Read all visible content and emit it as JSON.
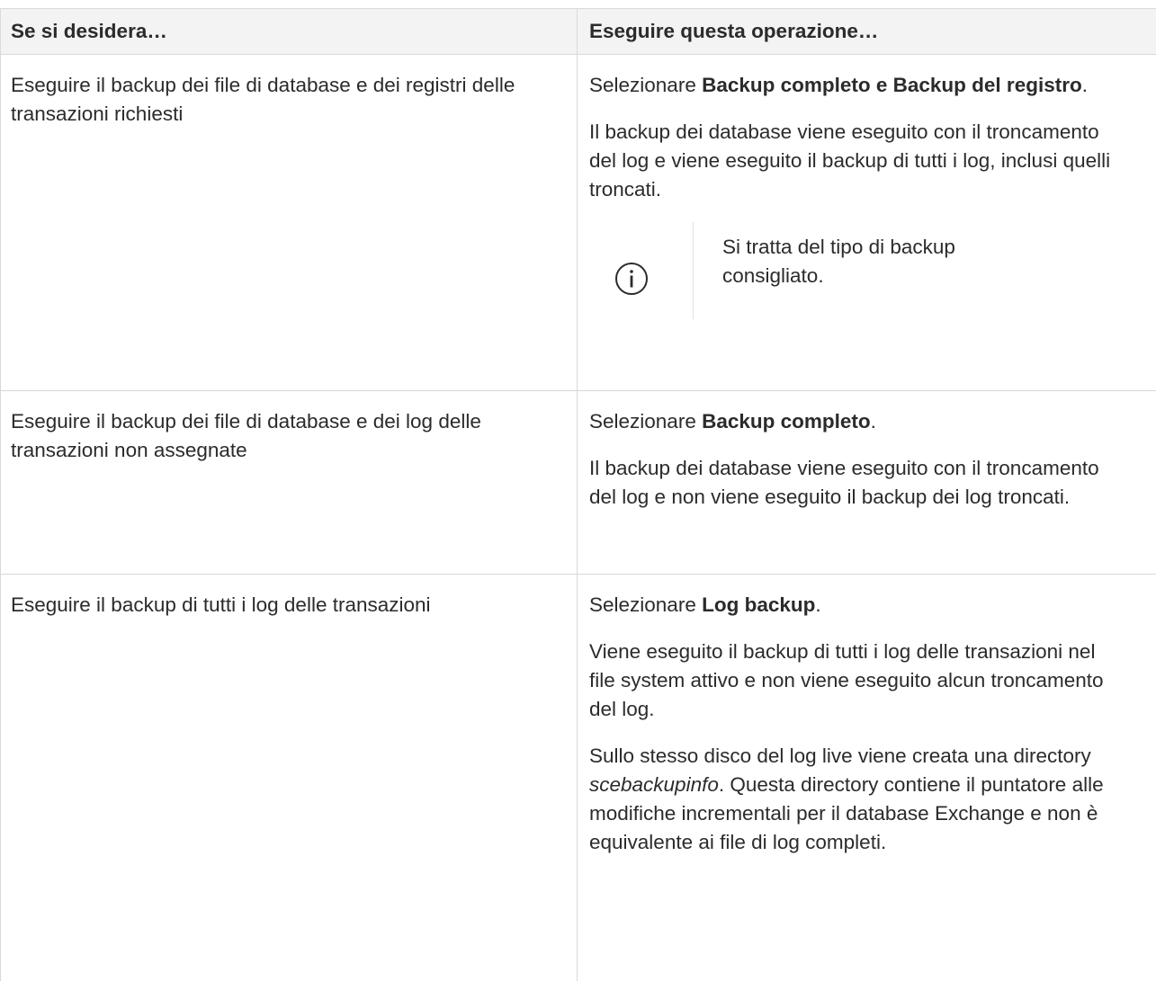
{
  "table": {
    "headers": [
      "Se si desidera…",
      "Eseguire questa operazione…"
    ],
    "rows": [
      {
        "want": "Eseguire il backup dei file di database e dei registri delle transazioni richiesti",
        "select_prefix": "Selezionare ",
        "select_bold": "Backup completo e Backup del registro",
        "select_suffix": ".",
        "description": "Il backup dei database viene eseguito con il troncamento del log e viene eseguito il backup di tutti i log, inclusi quelli troncati.",
        "note": {
          "icon": "info-icon",
          "text": "Si tratta del tipo di backup consigliato."
        }
      },
      {
        "want": "Eseguire il backup dei file di database e dei log delle transazioni non assegnate",
        "select_prefix": "Selezionare ",
        "select_bold": "Backup completo",
        "select_suffix": ".",
        "description": "Il backup dei database viene eseguito con il troncamento del log e non viene eseguito il backup dei log troncati."
      },
      {
        "want": "Eseguire il backup di tutti i log delle transazioni",
        "select_prefix": "Selezionare ",
        "select_bold": "Log backup",
        "select_suffix": ".",
        "description": "Viene eseguito il backup di tutti i log delle transazioni nel file system attivo e non viene eseguito alcun troncamento del log.",
        "extra": {
          "before": "Sullo stesso disco del log live viene creata una directory ",
          "italic": "scebackupinfo",
          "after": ". Questa directory contiene il puntatore alle modifiche incrementali per il database Exchange e non è equivalente ai file di log completi."
        }
      }
    ]
  },
  "colors": {
    "text": "#2b2b2b",
    "header_bg": "#f3f3f3",
    "border": "#d8d8d8",
    "icon": "#2b2b2b"
  }
}
